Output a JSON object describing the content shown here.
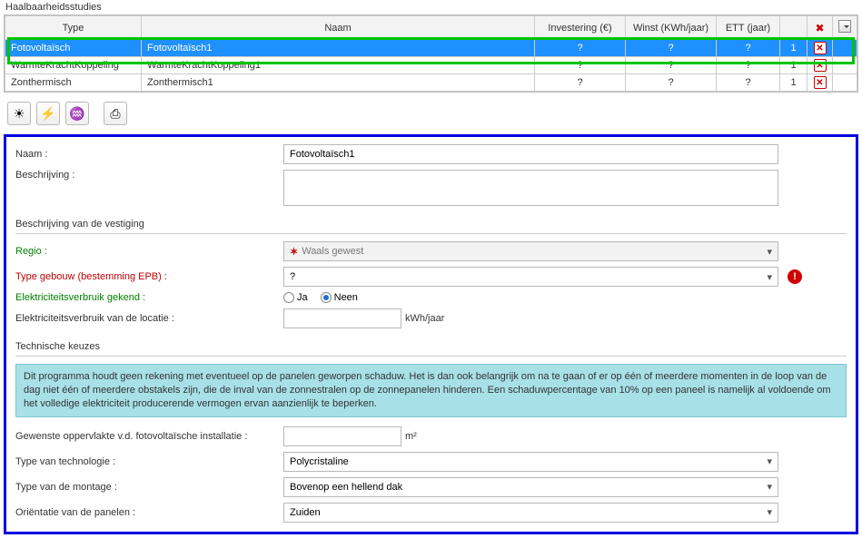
{
  "top_panel_title": "Haalbaarheidsstudies",
  "grid": {
    "headers": {
      "type": "Type",
      "name": "Naam",
      "invest": "Investering (€)",
      "profit": "Winst (KWh/jaar)",
      "ett": "ETT (jaar)",
      "del": ""
    },
    "rows": [
      {
        "type": "Fotovoltaïsch",
        "name": "Fotovoltaïsch1",
        "invest": "?",
        "profit": "?",
        "ett": "?",
        "count": "1",
        "selected": true
      },
      {
        "type": "WarmteKrachtKoppeling",
        "name": "WarmteKrachtKoppeling1",
        "invest": "?",
        "profit": "?",
        "ett": "?",
        "count": "1",
        "selected": false
      },
      {
        "type": "Zonthermisch",
        "name": "Zonthermisch1",
        "invest": "?",
        "profit": "?",
        "ett": "?",
        "count": "1",
        "selected": false
      }
    ]
  },
  "toolbar_icons": {
    "solar": "☀",
    "chp": "⚡",
    "therm": "♒",
    "print": "⎙"
  },
  "form": {
    "name_label": "Naam :",
    "name_value": "Fotovoltaïsch1",
    "desc_label": "Beschrijving :",
    "desc_value": "",
    "site_section": "Beschrijving van de vestiging",
    "region_label": "Regio :",
    "region_value": "Waals gewest",
    "building_label": "Type gebouw (bestemming EPB) :",
    "building_value": "?",
    "elec_known_label": "Elektriciteitsverbruik gekend :",
    "radio_yes": "Ja",
    "radio_no": "Neen",
    "elec_loc_label": "Elektriciteitsverbruik van de locatie :",
    "elec_loc_value": "",
    "elec_loc_unit": "kWh/jaar",
    "tech_section": "Technische keuzes",
    "info_text": "Dit programma houdt geen rekening met eventueel op de panelen geworpen schaduw. Het is dan ook belangrijk om na te gaan of er op één of meerdere momenten in de loop van de dag niet één of meerdere obstakels zijn, die de inval van de zonnestralen op de zonnepanelen hinderen. Een schaduwpercentage van 10% op een paneel is namelijk al voldoende om het volledige elektriciteit producerende vermogen ervan aanzienlijk te beperken.",
    "area_label": "Gewenste oppervlakte v.d.  fotovoltaïsche installatie :",
    "area_value": "",
    "area_unit": "m²",
    "techtype_label": "Type van technologie :",
    "techtype_value": "Polycristaline",
    "mount_label": "Type van de montage :",
    "mount_value": "Bovenop een hellend dak",
    "orient_label": "Oriëntatie van de panelen :",
    "orient_value": "Zuiden"
  }
}
